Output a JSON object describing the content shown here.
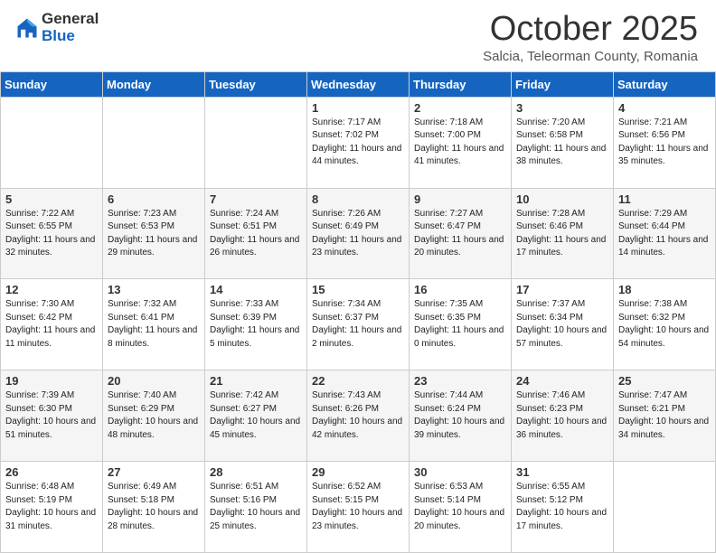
{
  "logo": {
    "general": "General",
    "blue": "Blue"
  },
  "header": {
    "month": "October 2025",
    "location": "Salcia, Teleorman County, Romania"
  },
  "days_of_week": [
    "Sunday",
    "Monday",
    "Tuesday",
    "Wednesday",
    "Thursday",
    "Friday",
    "Saturday"
  ],
  "weeks": [
    [
      {
        "day": "",
        "info": ""
      },
      {
        "day": "",
        "info": ""
      },
      {
        "day": "",
        "info": ""
      },
      {
        "day": "1",
        "info": "Sunrise: 7:17 AM\nSunset: 7:02 PM\nDaylight: 11 hours and 44 minutes."
      },
      {
        "day": "2",
        "info": "Sunrise: 7:18 AM\nSunset: 7:00 PM\nDaylight: 11 hours and 41 minutes."
      },
      {
        "day": "3",
        "info": "Sunrise: 7:20 AM\nSunset: 6:58 PM\nDaylight: 11 hours and 38 minutes."
      },
      {
        "day": "4",
        "info": "Sunrise: 7:21 AM\nSunset: 6:56 PM\nDaylight: 11 hours and 35 minutes."
      }
    ],
    [
      {
        "day": "5",
        "info": "Sunrise: 7:22 AM\nSunset: 6:55 PM\nDaylight: 11 hours and 32 minutes."
      },
      {
        "day": "6",
        "info": "Sunrise: 7:23 AM\nSunset: 6:53 PM\nDaylight: 11 hours and 29 minutes."
      },
      {
        "day": "7",
        "info": "Sunrise: 7:24 AM\nSunset: 6:51 PM\nDaylight: 11 hours and 26 minutes."
      },
      {
        "day": "8",
        "info": "Sunrise: 7:26 AM\nSunset: 6:49 PM\nDaylight: 11 hours and 23 minutes."
      },
      {
        "day": "9",
        "info": "Sunrise: 7:27 AM\nSunset: 6:47 PM\nDaylight: 11 hours and 20 minutes."
      },
      {
        "day": "10",
        "info": "Sunrise: 7:28 AM\nSunset: 6:46 PM\nDaylight: 11 hours and 17 minutes."
      },
      {
        "day": "11",
        "info": "Sunrise: 7:29 AM\nSunset: 6:44 PM\nDaylight: 11 hours and 14 minutes."
      }
    ],
    [
      {
        "day": "12",
        "info": "Sunrise: 7:30 AM\nSunset: 6:42 PM\nDaylight: 11 hours and 11 minutes."
      },
      {
        "day": "13",
        "info": "Sunrise: 7:32 AM\nSunset: 6:41 PM\nDaylight: 11 hours and 8 minutes."
      },
      {
        "day": "14",
        "info": "Sunrise: 7:33 AM\nSunset: 6:39 PM\nDaylight: 11 hours and 5 minutes."
      },
      {
        "day": "15",
        "info": "Sunrise: 7:34 AM\nSunset: 6:37 PM\nDaylight: 11 hours and 2 minutes."
      },
      {
        "day": "16",
        "info": "Sunrise: 7:35 AM\nSunset: 6:35 PM\nDaylight: 11 hours and 0 minutes."
      },
      {
        "day": "17",
        "info": "Sunrise: 7:37 AM\nSunset: 6:34 PM\nDaylight: 10 hours and 57 minutes."
      },
      {
        "day": "18",
        "info": "Sunrise: 7:38 AM\nSunset: 6:32 PM\nDaylight: 10 hours and 54 minutes."
      }
    ],
    [
      {
        "day": "19",
        "info": "Sunrise: 7:39 AM\nSunset: 6:30 PM\nDaylight: 10 hours and 51 minutes."
      },
      {
        "day": "20",
        "info": "Sunrise: 7:40 AM\nSunset: 6:29 PM\nDaylight: 10 hours and 48 minutes."
      },
      {
        "day": "21",
        "info": "Sunrise: 7:42 AM\nSunset: 6:27 PM\nDaylight: 10 hours and 45 minutes."
      },
      {
        "day": "22",
        "info": "Sunrise: 7:43 AM\nSunset: 6:26 PM\nDaylight: 10 hours and 42 minutes."
      },
      {
        "day": "23",
        "info": "Sunrise: 7:44 AM\nSunset: 6:24 PM\nDaylight: 10 hours and 39 minutes."
      },
      {
        "day": "24",
        "info": "Sunrise: 7:46 AM\nSunset: 6:23 PM\nDaylight: 10 hours and 36 minutes."
      },
      {
        "day": "25",
        "info": "Sunrise: 7:47 AM\nSunset: 6:21 PM\nDaylight: 10 hours and 34 minutes."
      }
    ],
    [
      {
        "day": "26",
        "info": "Sunrise: 6:48 AM\nSunset: 5:19 PM\nDaylight: 10 hours and 31 minutes."
      },
      {
        "day": "27",
        "info": "Sunrise: 6:49 AM\nSunset: 5:18 PM\nDaylight: 10 hours and 28 minutes."
      },
      {
        "day": "28",
        "info": "Sunrise: 6:51 AM\nSunset: 5:16 PM\nDaylight: 10 hours and 25 minutes."
      },
      {
        "day": "29",
        "info": "Sunrise: 6:52 AM\nSunset: 5:15 PM\nDaylight: 10 hours and 23 minutes."
      },
      {
        "day": "30",
        "info": "Sunrise: 6:53 AM\nSunset: 5:14 PM\nDaylight: 10 hours and 20 minutes."
      },
      {
        "day": "31",
        "info": "Sunrise: 6:55 AM\nSunset: 5:12 PM\nDaylight: 10 hours and 17 minutes."
      },
      {
        "day": "",
        "info": ""
      }
    ]
  ]
}
